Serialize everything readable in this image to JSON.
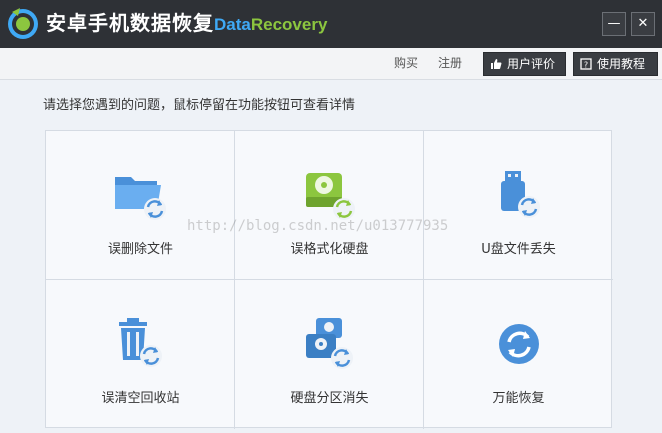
{
  "titlebar": {
    "title": "安卓手机数据恢复",
    "brand_part1": "Data",
    "brand_part2": "Recovery",
    "minimize_label": "—",
    "close_label": "✕"
  },
  "toolbar": {
    "buy_label": "购买",
    "register_label": "注册",
    "review_label": "用户评价",
    "tutorial_label": "使用教程"
  },
  "main": {
    "instruction": "请选择您遇到的问题，鼠标停留在功能按钮可查看详情",
    "tiles": [
      {
        "label": "误删除文件",
        "icon": "folder-recover-icon"
      },
      {
        "label": "误格式化硬盘",
        "icon": "disk-recover-icon"
      },
      {
        "label": "U盘文件丢失",
        "icon": "usb-recover-icon"
      },
      {
        "label": "误清空回收站",
        "icon": "trash-recover-icon"
      },
      {
        "label": "硬盘分区消失",
        "icon": "partition-recover-icon"
      },
      {
        "label": "万能恢复",
        "icon": "universal-recover-icon"
      }
    ],
    "watermark": "http://blog.csdn.net/u013777935"
  },
  "colors": {
    "titlebar": "#2e3136",
    "brand_data": "#3fa9f5",
    "brand_recovery": "#8cc63f",
    "icon_blue": "#4a90d9",
    "icon_green": "#8cc63f"
  }
}
